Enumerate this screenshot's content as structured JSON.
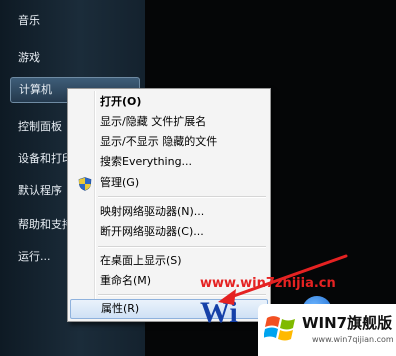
{
  "start_menu": {
    "items": [
      {
        "label": "音乐"
      },
      {
        "label": "游戏"
      },
      {
        "label": "计算机"
      },
      {
        "label": "控制面板"
      },
      {
        "label": "设备和打印机"
      },
      {
        "label": "默认程序"
      },
      {
        "label": "帮助和支持"
      },
      {
        "label": "运行..."
      }
    ]
  },
  "context_menu": {
    "items": [
      {
        "label": "打开(O)"
      },
      {
        "label": "显示/隐藏 文件扩展名"
      },
      {
        "label": "显示/不显示 隐藏的文件"
      },
      {
        "label": "搜索Everything..."
      },
      {
        "label": "管理(G)"
      },
      {
        "label": "映射网络驱动器(N)..."
      },
      {
        "label": "断开网络驱动器(C)..."
      },
      {
        "label": "在桌面上显示(S)"
      },
      {
        "label": "重命名(M)"
      },
      {
        "label": "属性(R)"
      }
    ],
    "shield_icon": "uac-shield-icon"
  },
  "watermark": {
    "url": "www.win7zhijia.cn",
    "logo_title": "WIN7旗舰版",
    "logo_sub": "www.win7qijian.com",
    "win_text": "Wi"
  },
  "colors": {
    "watermark_red": "#e52222",
    "highlight_border": "#8fb2dd"
  }
}
